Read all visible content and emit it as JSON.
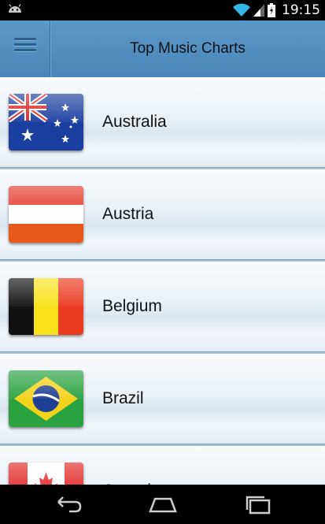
{
  "status_bar": {
    "time": "19:15",
    "icons": [
      "android-icon",
      "wifi-icon",
      "signal-icon",
      "battery-icon"
    ]
  },
  "action_bar": {
    "title": "Top Music Charts",
    "menu_icon": "hamburger-menu-icon"
  },
  "countries": [
    {
      "name": "Australia",
      "flag": "australia-flag"
    },
    {
      "name": "Austria",
      "flag": "austria-flag"
    },
    {
      "name": "Belgium",
      "flag": "belgium-flag"
    },
    {
      "name": "Brazil",
      "flag": "brazil-flag"
    },
    {
      "name": "Canada",
      "flag": "canada-flag"
    }
  ],
  "nav_bar": {
    "icons": [
      "back-icon",
      "home-icon",
      "recent-apps-icon"
    ]
  },
  "colors": {
    "action_bar": "#4f8ec0",
    "status_bar": "#000000",
    "wifi": "#33b5e5"
  }
}
